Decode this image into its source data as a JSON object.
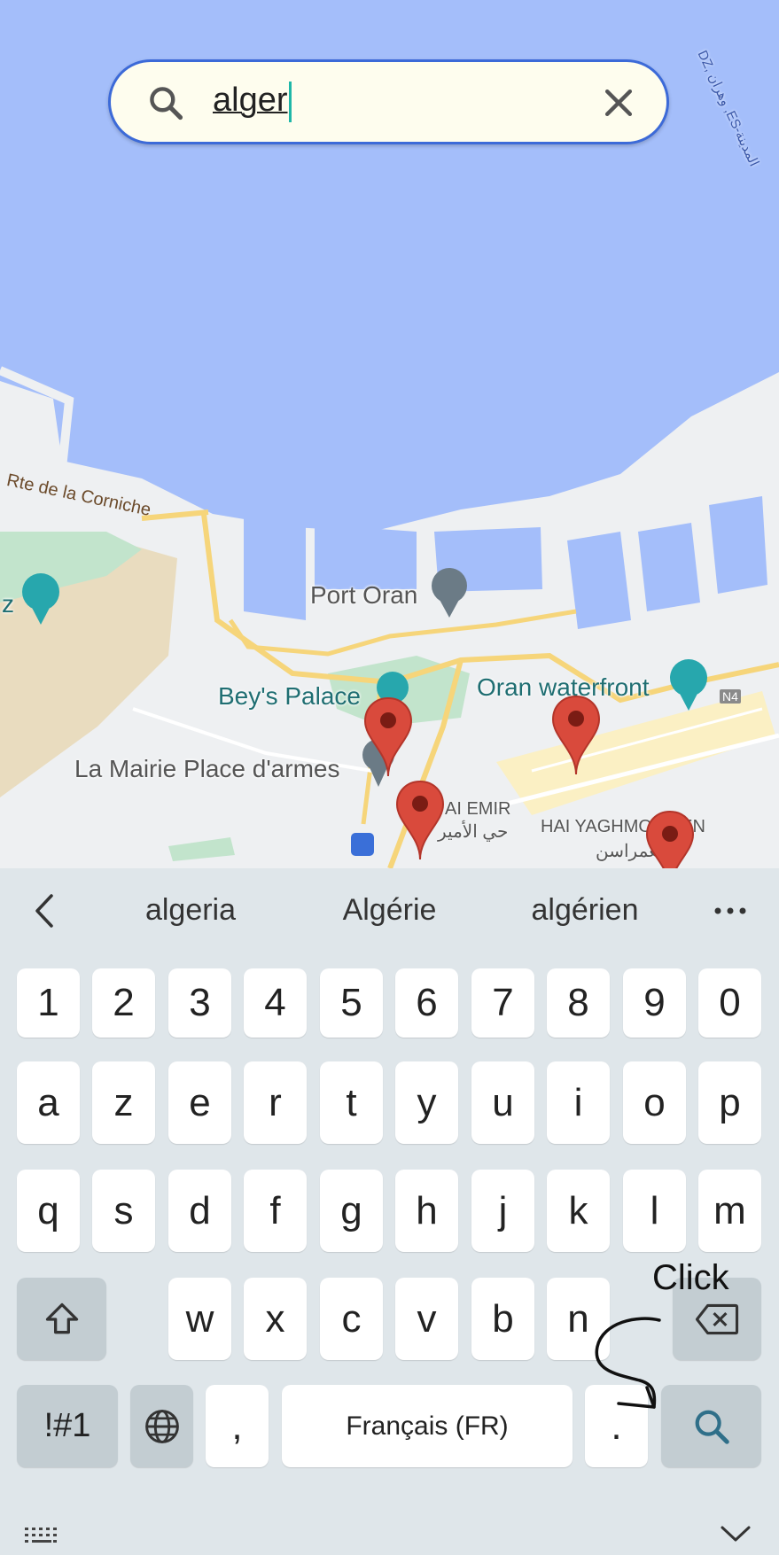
{
  "map": {
    "labels": {
      "corniche": "Rte de la Corniche",
      "port": "Port Oran",
      "beys": "Bey's Palace",
      "waterfront": "Oran waterfront",
      "mairie": "La Mairie Place d'armes",
      "emir": "AI EMIR",
      "emir_ar": "حي الأمير",
      "yaghmo": "HAI YAGHMO      SSEN",
      "yaghmo_ar": "يغمراسن",
      "corner": "DZ, وهران ,ES-المدينة",
      "left_edge": "z",
      "road_badge": "N4"
    },
    "colors": {
      "water": "#a4befa",
      "land": "#eef0f2",
      "park": "#c2e4cc",
      "sand": "#e9dcbf",
      "road": "#f6d57a",
      "pin": "#d94a3c"
    }
  },
  "search": {
    "query": "alger",
    "icon": "search-icon",
    "clear_icon": "close-icon"
  },
  "keyboard": {
    "suggestions": [
      "algeria",
      "Algérie",
      "algérien"
    ],
    "numbers": [
      "1",
      "2",
      "3",
      "4",
      "5",
      "6",
      "7",
      "8",
      "9",
      "0"
    ],
    "row1": [
      "a",
      "z",
      "e",
      "r",
      "t",
      "y",
      "u",
      "i",
      "o",
      "p"
    ],
    "row2": [
      "q",
      "s",
      "d",
      "f",
      "g",
      "h",
      "j",
      "k",
      "l",
      "m"
    ],
    "row3": [
      "w",
      "x",
      "c",
      "v",
      "b",
      "n"
    ],
    "symbols": "!#1",
    "comma": ",",
    "space": "Français (FR)",
    "period": ".",
    "colors": {
      "key": "#ffffff",
      "function_key": "#c3cdd2",
      "background": "#dfe6ea",
      "go": "#2f6f89"
    }
  },
  "annotation": {
    "text": "Click"
  }
}
